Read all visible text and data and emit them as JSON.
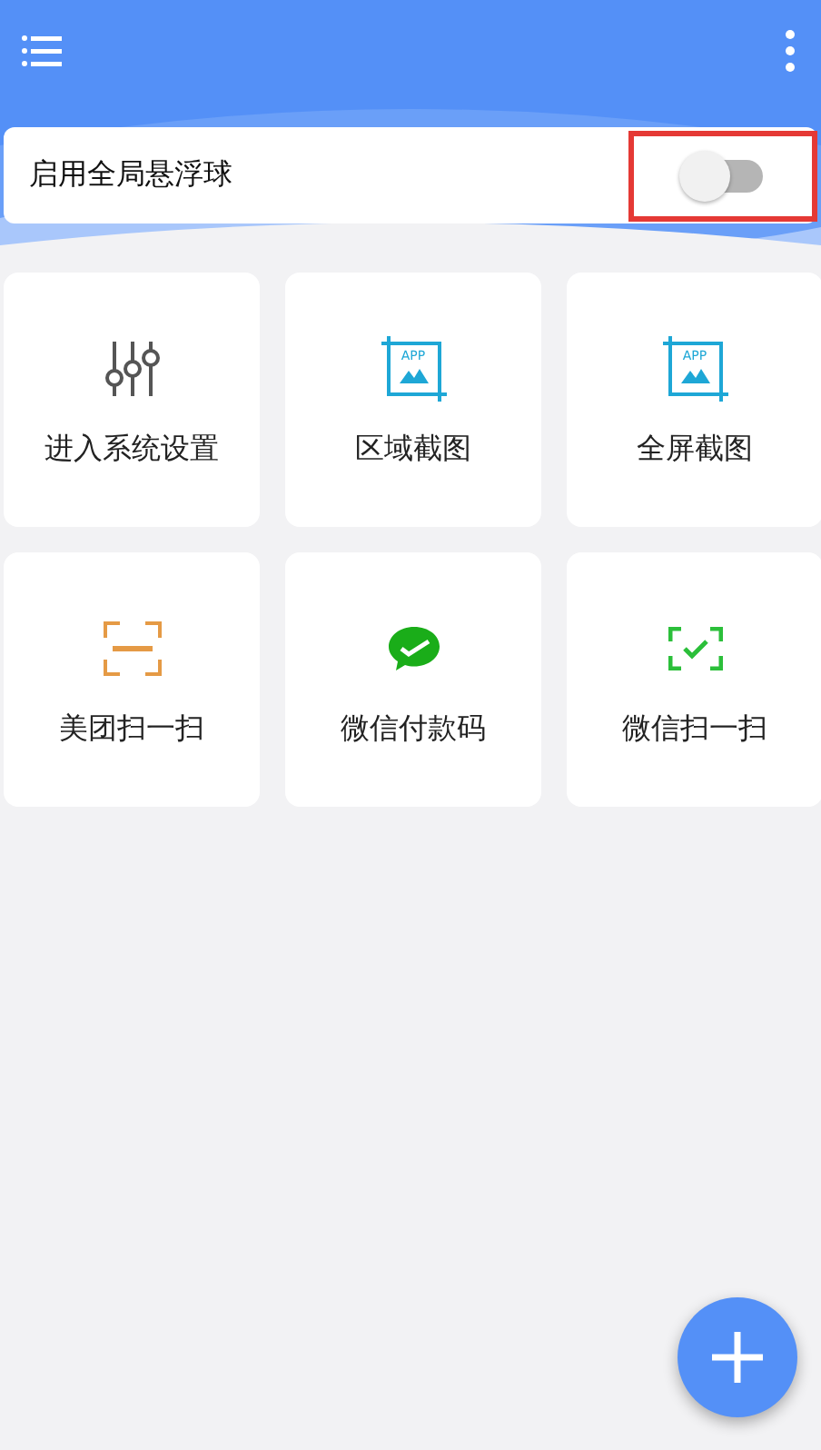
{
  "float_ball": {
    "label": "启用全局悬浮球",
    "on": false,
    "highlighted": true
  },
  "tiles": [
    {
      "kind": "sliders",
      "label": "进入系统设置"
    },
    {
      "kind": "crop",
      "label": "区域截图",
      "icon_text": "APP"
    },
    {
      "kind": "crop",
      "label": "全屏截图",
      "icon_text": "APP"
    },
    {
      "kind": "scan",
      "label": "美团扫一扫",
      "color": "#e59a45"
    },
    {
      "kind": "wechat",
      "label": "微信付款码",
      "color": "#1aad19"
    },
    {
      "kind": "scancheck",
      "label": "微信扫一扫",
      "color": "#2bbf3a"
    }
  ]
}
